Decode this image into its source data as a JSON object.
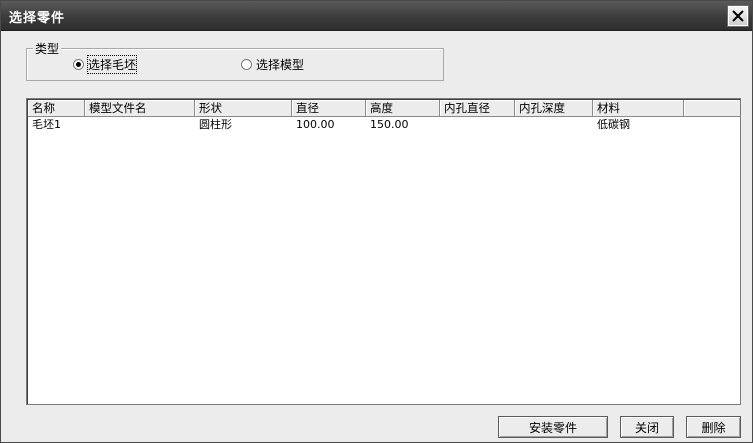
{
  "window": {
    "title": "选择零件"
  },
  "type_group": {
    "legend": "类型",
    "options": [
      {
        "label": "选择毛坯",
        "selected": true
      },
      {
        "label": "选择模型",
        "selected": false
      }
    ]
  },
  "table": {
    "columns": [
      "名称",
      "模型文件名",
      "形状",
      "直径",
      "高度",
      "内孔直径",
      "内孔深度",
      "材料"
    ],
    "rows": [
      [
        "毛坯1",
        "",
        "圆柱形",
        "100.00",
        "150.00",
        "",
        "",
        "低碳钢"
      ]
    ]
  },
  "buttons": {
    "install": "安装零件",
    "close": "关闭",
    "delete": "删除"
  }
}
